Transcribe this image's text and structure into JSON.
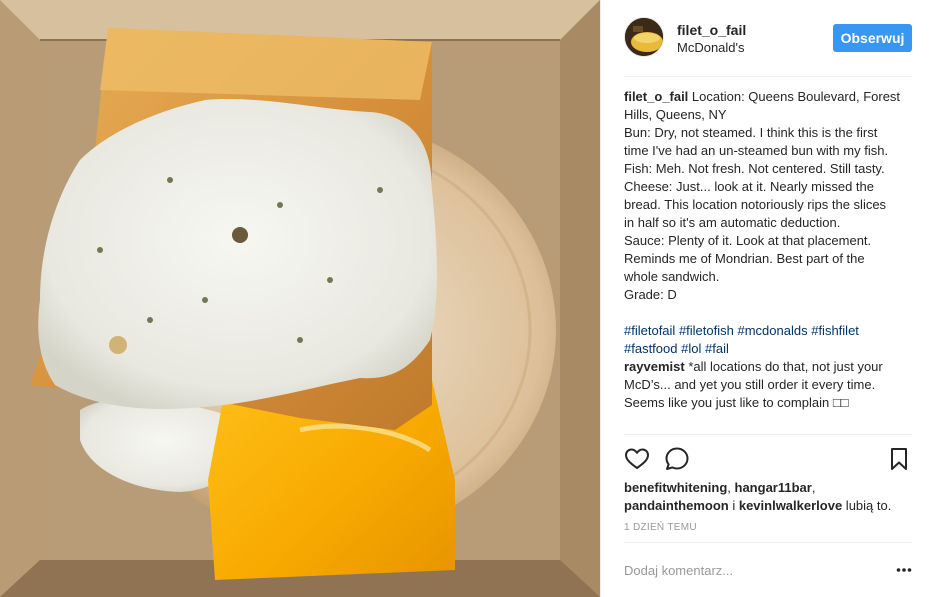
{
  "post": {
    "username": "filet_o_fail",
    "location": "McDonald's",
    "follow_label": "Obserwuj"
  },
  "caption": {
    "username": "filet_o_fail",
    "lines": [
      "Location: Queens Boulevard, Forest",
      "Hills, Queens, NY",
      "Bun: Dry, not steamed. I think this is the first",
      "time I've had an un-steamed bun with my fish.",
      "Fish: Meh. Not fresh. Not centered. Still tasty.",
      "Cheese: Just... look at it. Nearly missed the",
      "bread. This location notoriously rips the slices",
      "in half so it's am automatic deduction.",
      "Sauce: Plenty of it. Look at that placement.",
      "Reminds me of Mondrian. Best part of the",
      "whole sandwich.",
      "Grade: D"
    ],
    "hashtags_line1": [
      "#filetofail",
      "#filetofish",
      "#mcdonalds",
      "#fishfilet"
    ],
    "hashtags_line2": [
      "#fastfood",
      "#lol",
      "#fail"
    ]
  },
  "comment": {
    "username": "rayvemist",
    "lines": [
      "*all locations do that, not just your",
      "McD’s... and yet you still order it every time.",
      "Seems like you just like to complain □□"
    ]
  },
  "actions": {
    "like_icon": "heart-outline",
    "comment_icon": "speech-bubble",
    "save_icon": "bookmark"
  },
  "likes": {
    "user1": "benefitwhitening",
    "sep1": ", ",
    "user2": "hangar11bar",
    "sep2": ",",
    "user3": "pandainthemoon",
    "joiner": " i ",
    "user4": "kevinlwalkerlove",
    "suffix": " lubią to."
  },
  "timestamp": "1 DZIEŃ TEMU",
  "comment_input": {
    "placeholder": "Dodaj komentarz..."
  },
  "colors": {
    "follow_button": "#3897f0",
    "hashtag": "#003569",
    "muted_text": "#999999"
  }
}
